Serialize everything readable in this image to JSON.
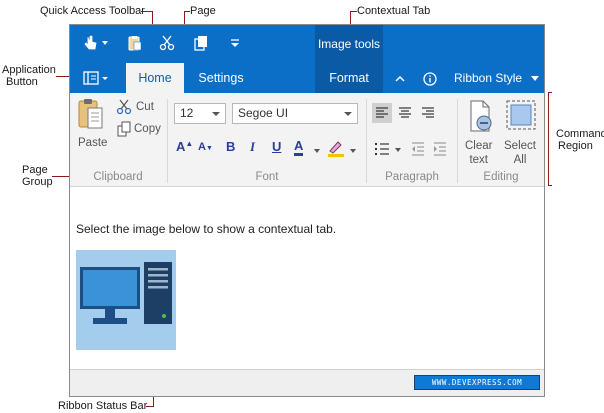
{
  "annotations": {
    "quick_access_toolbar": "Quick Access Toolbar",
    "page": "Page",
    "contextual_tab": "Contextual Tab",
    "application_button_line1": "Application",
    "application_button_line2": "Button",
    "command_region_line1": "Command",
    "command_region_line2": "Region",
    "page_group_line1": "Page",
    "page_group_line2": "Group",
    "ribbon_status_bar": "Ribbon Status Bar"
  },
  "titlebar": {
    "contextual_category": "Image tools"
  },
  "tabs": {
    "home": "Home",
    "settings": "Settings",
    "format": "Format"
  },
  "ribbon_style_label": "Ribbon Style",
  "clipboard": {
    "paste": "Paste",
    "cut": "Cut",
    "copy": "Copy",
    "caption": "Clipboard"
  },
  "font": {
    "size": "12",
    "family": "Segoe UI",
    "caption": "Font"
  },
  "paragraph": {
    "caption": "Paragraph"
  },
  "editing": {
    "clear_line1": "Clear",
    "clear_line2": "text",
    "select_line1": "Select",
    "select_line2": "All",
    "caption": "Editing"
  },
  "content": {
    "text": "Select the image below to show a contextual tab."
  },
  "status": {
    "badge": "WWW.DEVEXPRESS.COM"
  },
  "colors": {
    "accent": "#0b6fc8",
    "contextual": "#0a5aa6",
    "callout_line": "#8b1a1a"
  }
}
